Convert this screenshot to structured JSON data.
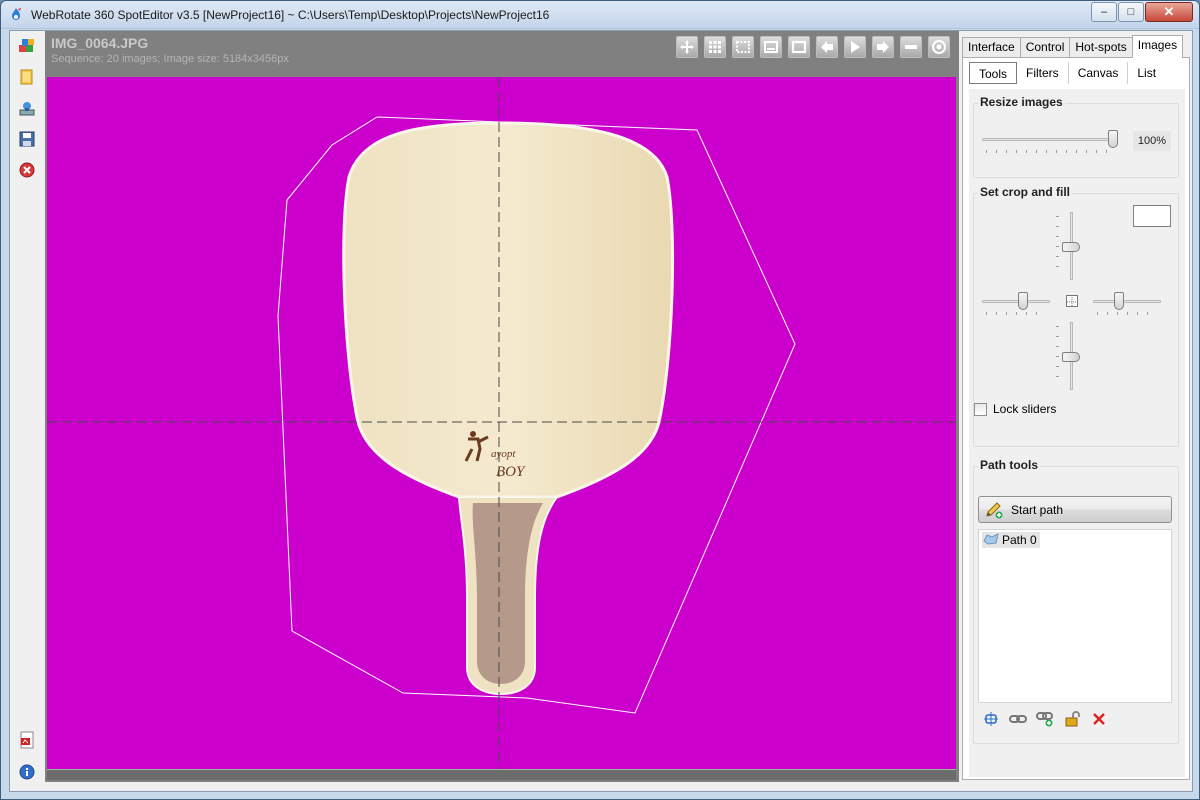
{
  "window": {
    "title": "WebRotate 360 SpotEditor v3.5 [NewProject16] ~ C:\\Users\\Temp\\Desktop\\Projects\\NewProject16",
    "min_glyph": "–",
    "max_glyph": "□",
    "close_glyph": "✕"
  },
  "viewer": {
    "image_name": "IMG_0064.JPG",
    "image_info": "Sequence: 20 images; Image size: 5184x3456px",
    "canvas_color": "#cc00cc",
    "paddle_logo_top": "ayopt",
    "paddle_logo_bottom": "BOY"
  },
  "left_toolbar": [
    {
      "icon": "project-icon"
    },
    {
      "icon": "open-folder-icon"
    },
    {
      "icon": "publish-icon"
    },
    {
      "icon": "save-icon"
    },
    {
      "icon": "close-project-icon"
    },
    {
      "icon": "pdf-icon"
    },
    {
      "icon": "info-icon"
    }
  ],
  "view_toolbar": [
    {
      "icon": "move-icon"
    },
    {
      "icon": "grid-icon"
    },
    {
      "icon": "selection-icon"
    },
    {
      "icon": "window-icon"
    },
    {
      "icon": "frame-icon"
    },
    {
      "icon": "arrow-left-icon"
    },
    {
      "icon": "play-icon"
    },
    {
      "icon": "arrow-right-icon"
    },
    {
      "icon": "minus-icon"
    },
    {
      "icon": "target-icon"
    }
  ],
  "tabs": [
    "Interface",
    "Control",
    "Hot-spots",
    "Images"
  ],
  "active_tab": "Images",
  "subtabs": [
    "Tools",
    "Filters",
    "Canvas",
    "List"
  ],
  "active_subtab": "Tools",
  "resize": {
    "title": "Resize images",
    "value": 1.0,
    "value_label": "100%"
  },
  "crop": {
    "title": "Set crop and fill",
    "fill_color": "#ffffff",
    "top_slider": 0.5,
    "left_slider": 0.55,
    "right_slider": 0.35,
    "bottom_slider": 0.5,
    "lock_label": "Lock sliders",
    "lock_checked": false
  },
  "path_tools": {
    "title": "Path tools",
    "start_label": "Start path",
    "paths": [
      "Path 0"
    ],
    "tools": [
      {
        "icon": "select-path-icon"
      },
      {
        "icon": "link-icon"
      },
      {
        "icon": "add-link-icon"
      },
      {
        "icon": "unlock-icon"
      },
      {
        "icon": "delete-icon"
      }
    ]
  }
}
